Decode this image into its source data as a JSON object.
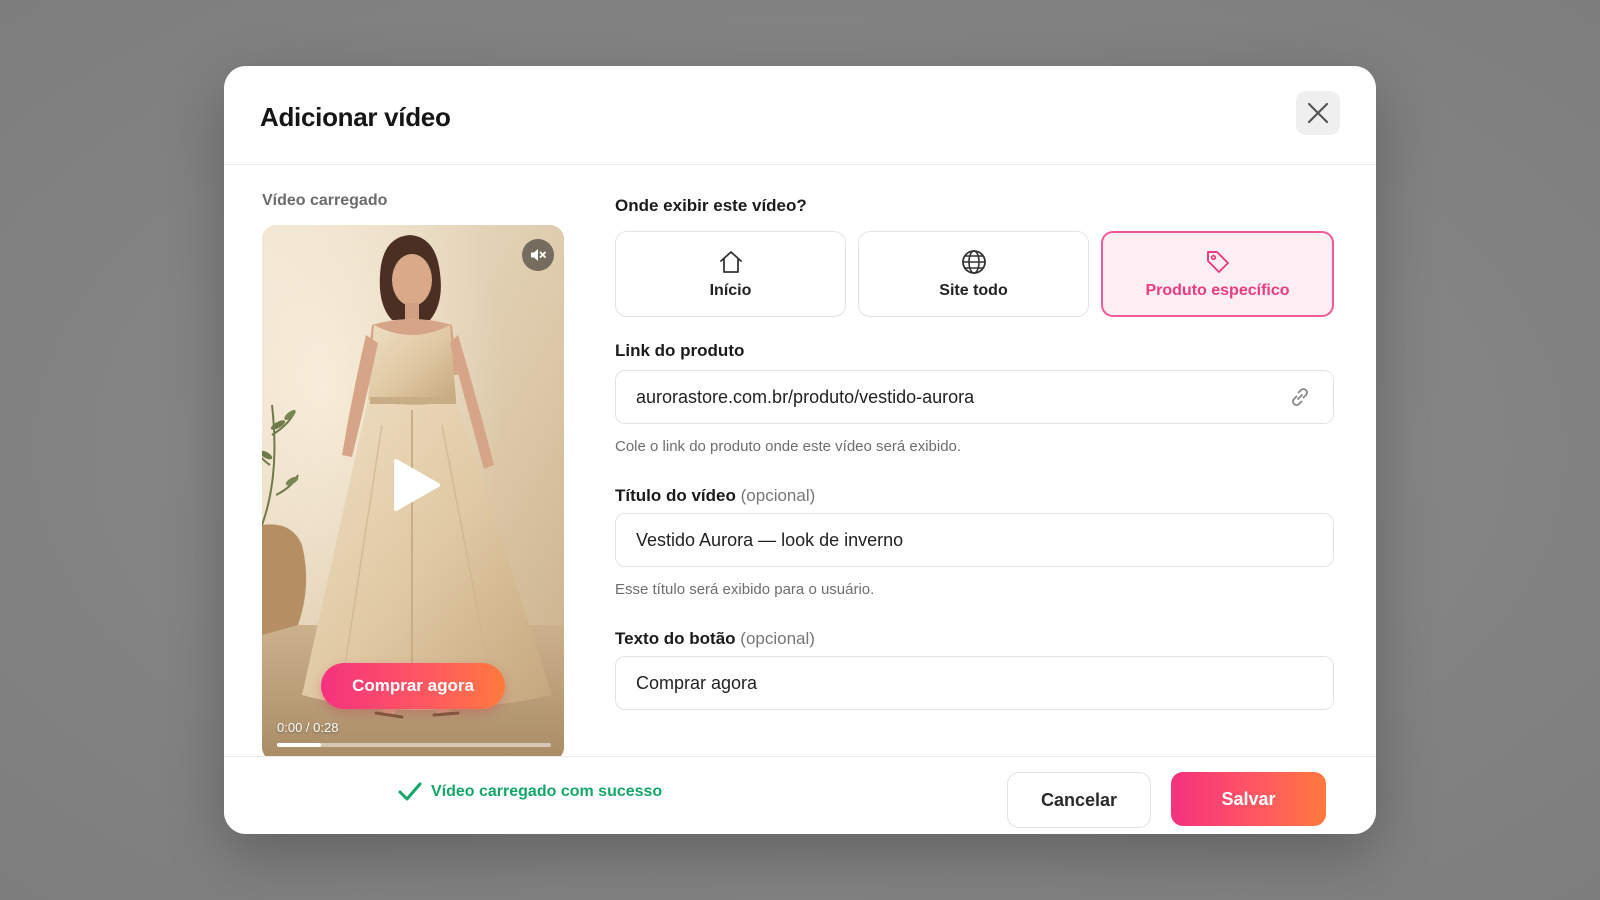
{
  "modal": {
    "title": "Adicionar vídeo",
    "close_icon": "close-icon"
  },
  "video_panel": {
    "label": "Vídeo carregado",
    "mute_icon": "volume-mute-icon",
    "play_icon": "play-icon",
    "cta_label": "Comprar agora",
    "time": "0:00 / 0:28",
    "progress": 0.16
  },
  "placement": {
    "question": "Onde exibir este vídeo?",
    "options": [
      {
        "label": "Início",
        "icon": "home-icon",
        "selected": false
      },
      {
        "label": "Site todo",
        "icon": "globe-icon",
        "selected": false
      },
      {
        "label": "Produto específico",
        "icon": "tag-icon",
        "selected": true
      }
    ]
  },
  "product_link": {
    "label": "Link do produto",
    "value": "aurorastore.com.br/produto/vestido-aurora",
    "hint": "Cole o link do produto onde este vídeo será exibido.",
    "icon": "link-icon"
  },
  "video_title": {
    "label": "Título do vídeo",
    "optional": "(opcional)",
    "value": "Vestido Aurora — look de inverno",
    "hint": "Esse título será exibido para o usuário."
  },
  "button_text": {
    "label": "Texto do botão",
    "optional": "(opcional)",
    "value": "Comprar agora"
  },
  "footer": {
    "success_message": "Vídeo carregado com sucesso",
    "success_icon": "check-icon",
    "cancel_label": "Cancelar",
    "save_label": "Salvar"
  },
  "colors": {
    "accent": "#f25a97",
    "success": "#15a66a",
    "gradient_start": "#f5317f",
    "gradient_end": "#ff7a3d"
  }
}
